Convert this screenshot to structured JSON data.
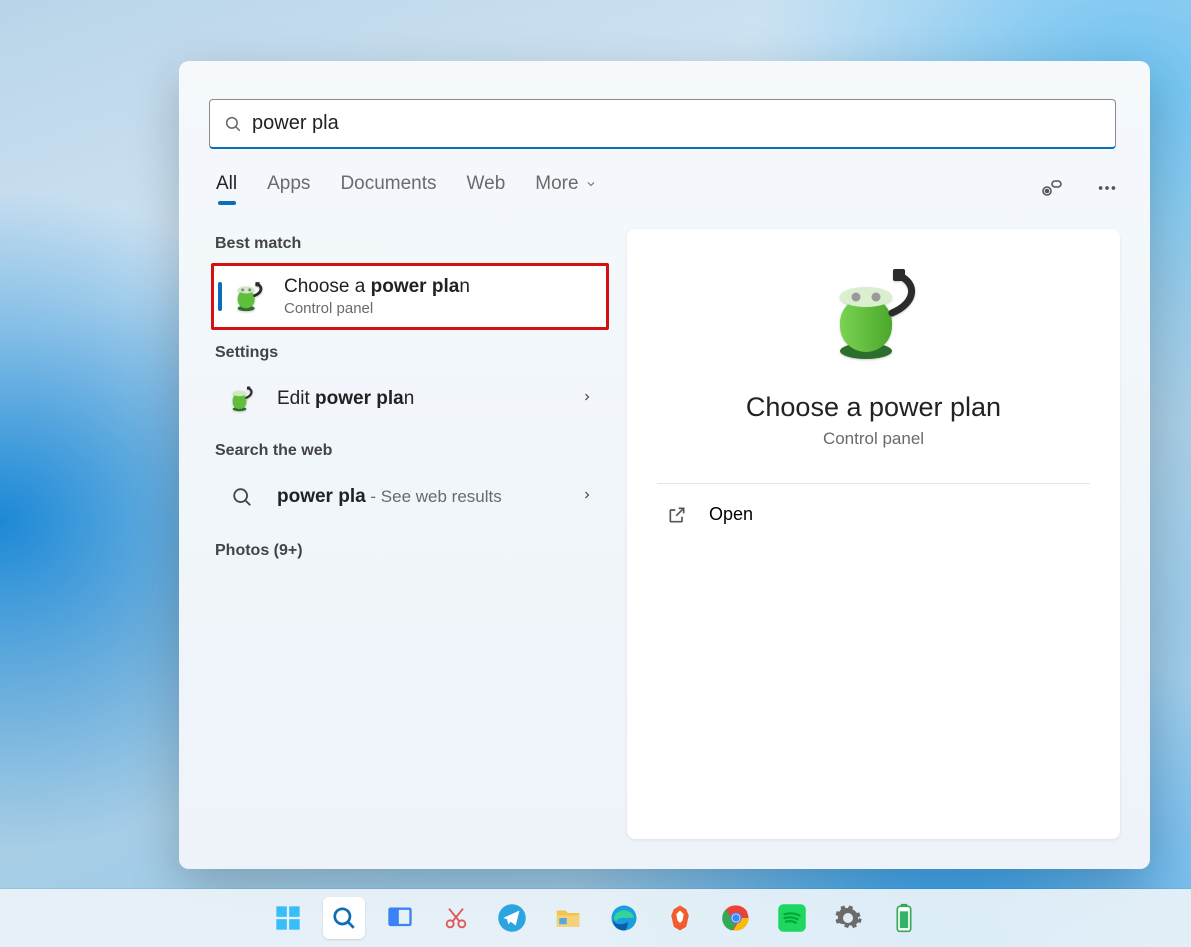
{
  "search": {
    "query": "power pla"
  },
  "filters": {
    "tabs": [
      "All",
      "Apps",
      "Documents",
      "Web",
      "More"
    ]
  },
  "sections": {
    "best_match": "Best match",
    "settings": "Settings",
    "search_web": "Search the web",
    "photos": "Photos (9+)"
  },
  "results": {
    "best": {
      "title_prefix": "Choose a ",
      "title_bold": "power pla",
      "title_suffix": "n",
      "subtitle": "Control panel",
      "icon": "battery-power-icon"
    },
    "settings": {
      "title_prefix": "Edit ",
      "title_bold": "power pla",
      "title_suffix": "n",
      "icon": "battery-power-icon"
    },
    "web": {
      "query_bold": "power pla",
      "query_suffix": "",
      "suffix": " - See web results",
      "icon": "search-icon"
    }
  },
  "preview": {
    "title": "Choose a power plan",
    "subtitle": "Control panel",
    "action": "Open",
    "icon": "battery-power-icon"
  },
  "taskbar": {
    "items": [
      {
        "name": "start",
        "active": false
      },
      {
        "name": "search",
        "active": true
      },
      {
        "name": "task-view",
        "active": false
      },
      {
        "name": "snip",
        "active": false
      },
      {
        "name": "telegram",
        "active": false
      },
      {
        "name": "file-explorer",
        "active": false
      },
      {
        "name": "edge",
        "active": false
      },
      {
        "name": "brave",
        "active": false
      },
      {
        "name": "chrome",
        "active": false
      },
      {
        "name": "spotify",
        "active": false
      },
      {
        "name": "settings",
        "active": false
      },
      {
        "name": "battery",
        "active": false
      }
    ]
  }
}
